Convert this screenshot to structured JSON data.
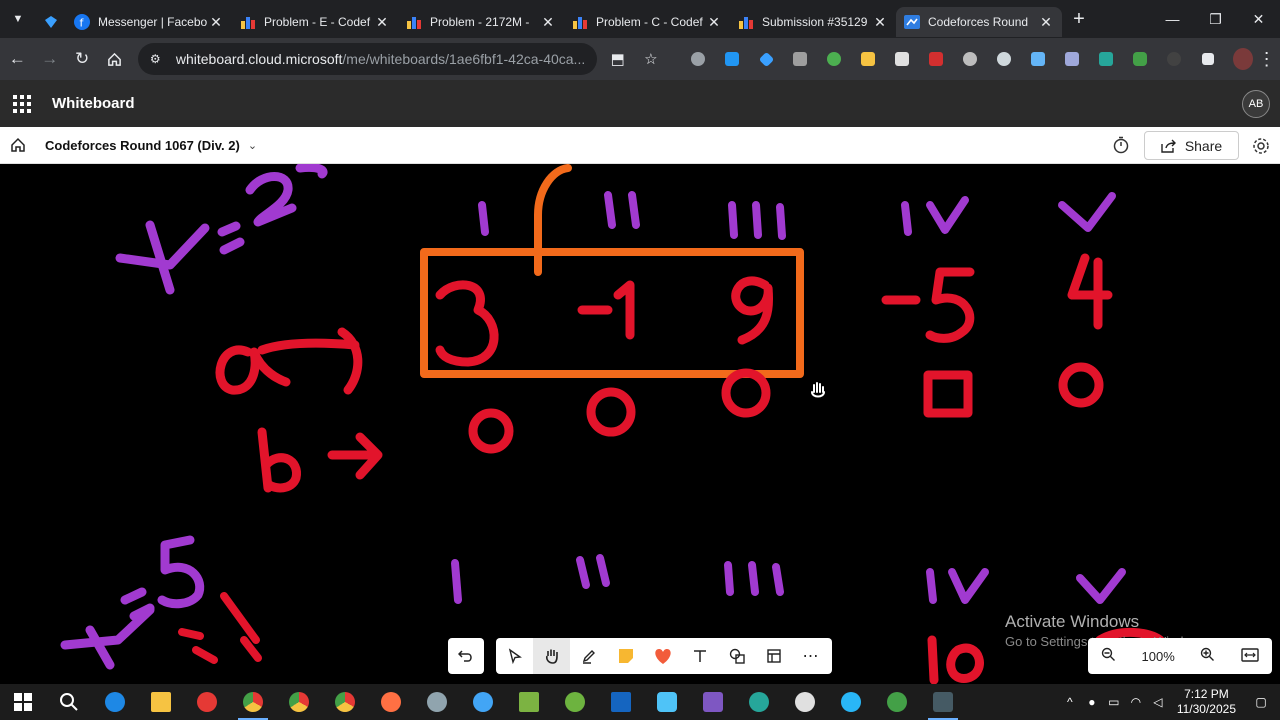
{
  "browser": {
    "tabs": [
      {
        "title": "",
        "pinned": true
      },
      {
        "title": "Messenger | Facebo"
      },
      {
        "title": "Problem - E - Codef"
      },
      {
        "title": "Problem - 2172M -"
      },
      {
        "title": "Problem - C - Codef"
      },
      {
        "title": "Submission #35129"
      },
      {
        "title": "Codeforces Round",
        "active": true
      }
    ],
    "url_host": "whiteboard.cloud.microsoft",
    "url_path": "/me/whiteboards/1ae6fbf1-42ca-40ca..."
  },
  "app": {
    "name": "Whiteboard",
    "avatar_initials": "AB"
  },
  "board": {
    "title": "Codeforces Round 1067 (Div. 2)",
    "share_label": "Share"
  },
  "canvas": {
    "top_row": {
      "roman": [
        "I",
        "II",
        "III",
        "IV",
        "V"
      ],
      "values": [
        "3",
        "-1",
        "9",
        "-5",
        "4"
      ],
      "marks": [
        "0",
        "0",
        "0",
        "□",
        "0"
      ]
    },
    "side_notes": [
      "k=2",
      "9→",
      "b→",
      "k=5"
    ]
  },
  "watermark": {
    "line1": "Activate Windows",
    "line2": "Go to Settings to activate Windows."
  },
  "zoom": {
    "level": "100%"
  },
  "taskbar": {
    "time": "7:12 PM",
    "date": "11/30/2025"
  }
}
